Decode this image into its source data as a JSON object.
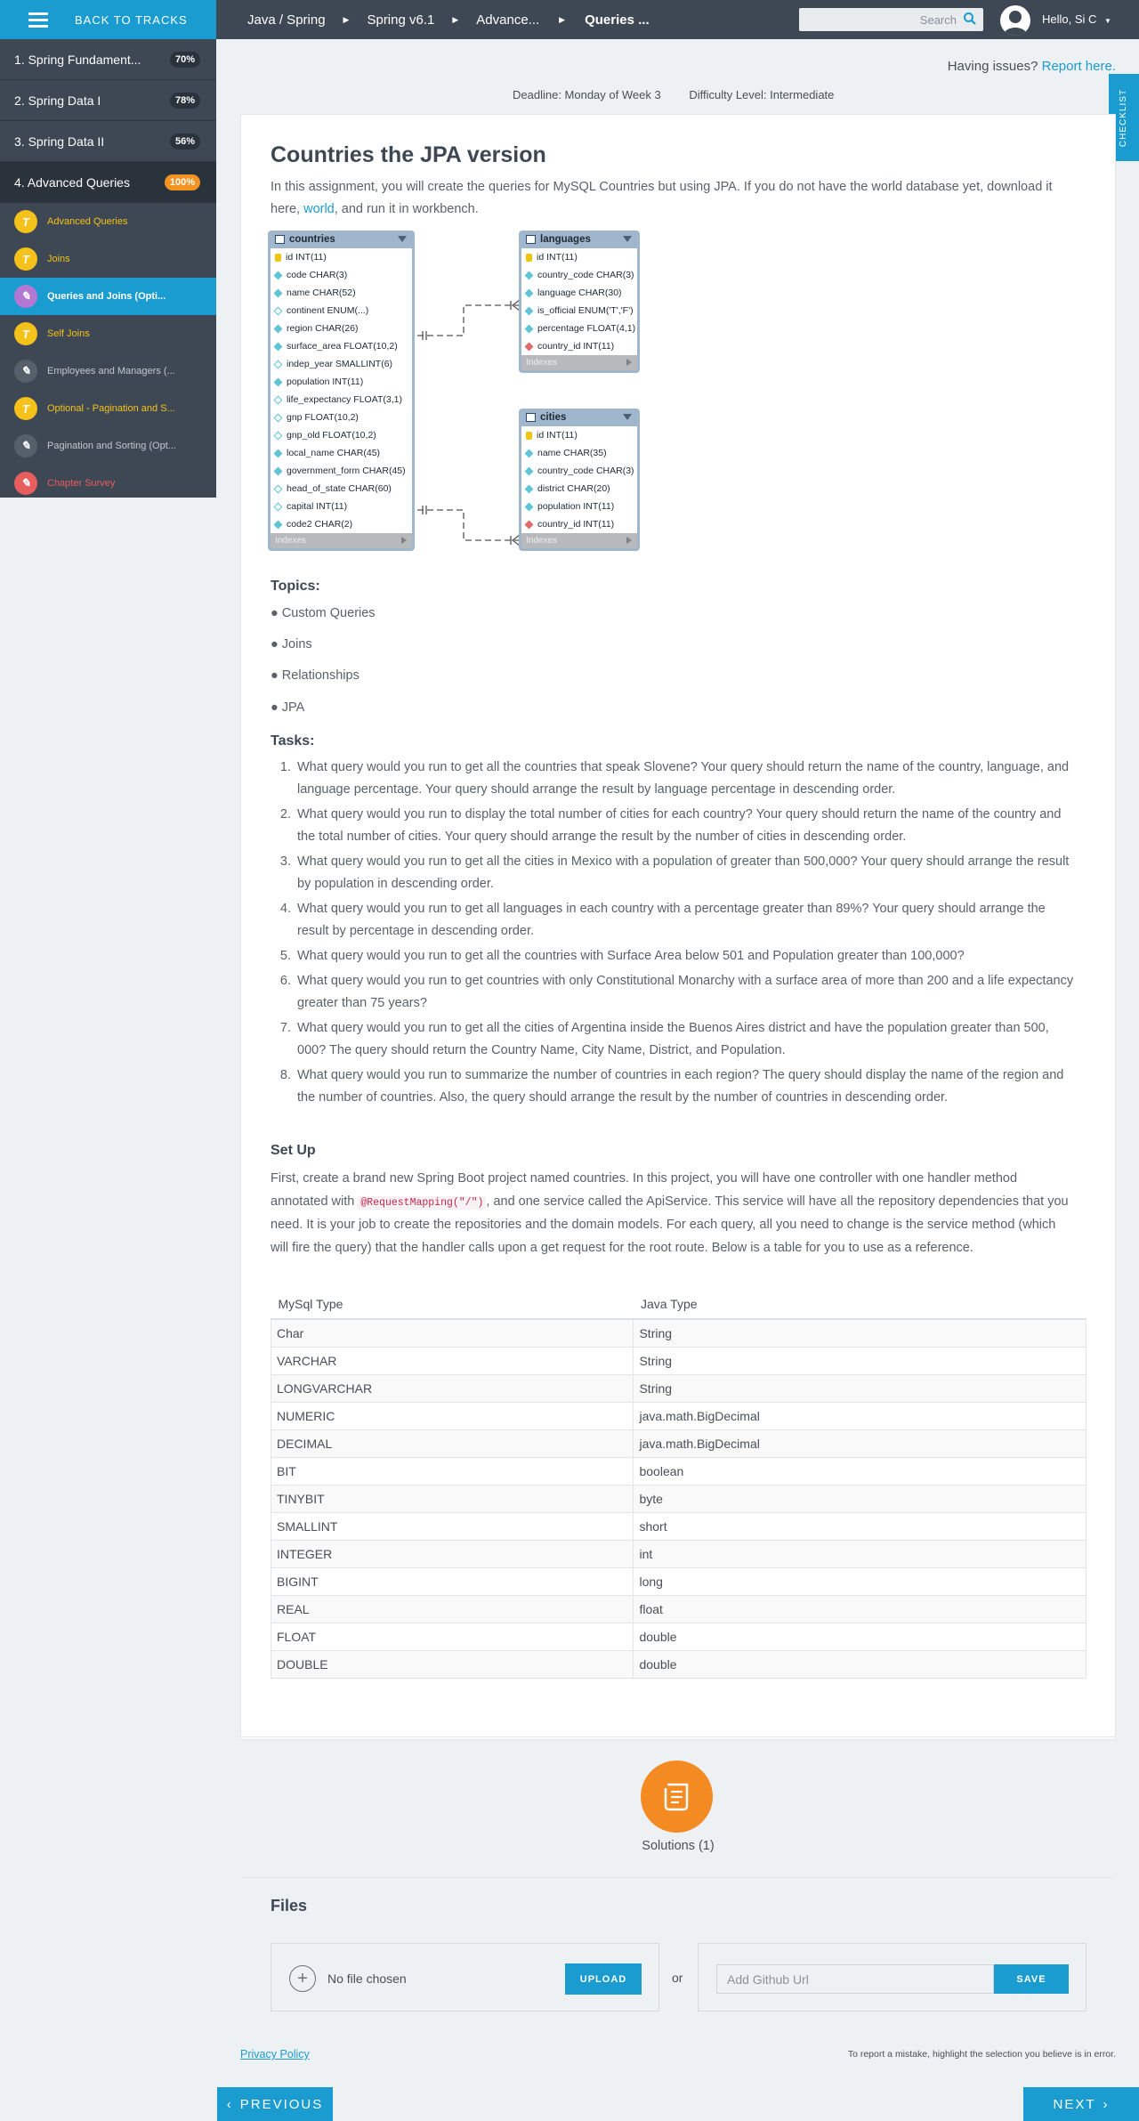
{
  "topbar": {
    "back_label": "BACK TO TRACKS",
    "breadcrumbs": [
      "Java / Spring",
      "Spring v6.1",
      "Advance...",
      "Queries ..."
    ],
    "search_placeholder": "Search",
    "user": "Hello, Si C"
  },
  "sidebar": {
    "tracks": [
      {
        "label": "1. Spring Fundament...",
        "progress": "70%"
      },
      {
        "label": "2. Spring Data I",
        "progress": "78%"
      },
      {
        "label": "3. Spring Data II",
        "progress": "56%"
      },
      {
        "label": "4. Advanced Queries",
        "progress": "100%"
      }
    ],
    "items": [
      {
        "label": "Advanced Queries",
        "icon": "t-icon"
      },
      {
        "label": "Joins",
        "icon": "t-icon"
      },
      {
        "label": "Queries and Joins (Opti...",
        "icon": "pencil-icon"
      },
      {
        "label": "Self Joins",
        "icon": "t-icon"
      },
      {
        "label": "Employees and Managers (...",
        "icon": "pencil-icon"
      },
      {
        "label": "Optional - Pagination and S...",
        "icon": "t-icon"
      },
      {
        "label": "Pagination and Sorting (Opt...",
        "icon": "pencil-icon"
      },
      {
        "label": "Chapter Survey",
        "icon": "survey-icon"
      }
    ]
  },
  "checklist_label": "CHECKLIST",
  "issues": {
    "text": "Having issues?",
    "link": "Report here."
  },
  "meta": {
    "deadline": "Deadline: Monday of Week 3",
    "difficulty": "Difficulty Level: Intermediate"
  },
  "assignment": {
    "title": "Countries the JPA version",
    "intro_1": "In this assignment, you will create the queries for MySQL Countries but using JPA. If you do not have the world database yet, download it here,",
    "intro_link": "world",
    "intro_2": ", and run it in workbench."
  },
  "er": {
    "countries": {
      "name": "countries",
      "columns": [
        "id INT(11)",
        "code CHAR(3)",
        "name CHAR(52)",
        "continent ENUM(...)",
        "region CHAR(26)",
        "surface_area FLOAT(10,2)",
        "indep_year SMALLINT(6)",
        "population INT(11)",
        "life_expectancy FLOAT(3,1)",
        "gnp FLOAT(10,2)",
        "gnp_old FLOAT(10,2)",
        "local_name CHAR(45)",
        "government_form CHAR(45)",
        "head_of_state CHAR(60)",
        "capital INT(11)",
        "code2 CHAR(2)"
      ]
    },
    "languages": {
      "name": "languages",
      "columns": [
        "id INT(11)",
        "country_code CHAR(3)",
        "language CHAR(30)",
        "is_official ENUM('T','F')",
        "percentage FLOAT(4,1)",
        "country_id INT(11)"
      ]
    },
    "cities": {
      "name": "cities",
      "columns": [
        "id INT(11)",
        "name CHAR(35)",
        "country_code CHAR(3)",
        "district CHAR(20)",
        "population INT(11)",
        "country_id INT(11)"
      ]
    },
    "indexes_label": "Indexes"
  },
  "topics": {
    "heading": "Topics:",
    "items": [
      "Custom Queries",
      "Joins",
      "Relationships",
      "JPA"
    ]
  },
  "tasks": {
    "heading": "Tasks:",
    "items": [
      "What query would you run to get all the countries that speak Slovene? Your query should return the name of the country, language, and language percentage. Your query should arrange the result by language percentage in descending order.",
      "What query would you run to display the total number of cities for each country? Your query should return the name of the country and the total number of cities. Your query should arrange the result by the number of cities in descending order.",
      "What query would you run to get all the cities in Mexico with a population of greater than 500,000? Your query should arrange the result by population in descending order.",
      "What query would you run to get all languages in each country with a percentage greater than 89%? Your query should arrange the result by percentage in descending order.",
      "What query would you run to get all the countries with Surface Area below 501 and Population greater than 100,000?",
      "What query would you run to get countries with only Constitutional Monarchy with a surface area of more than 200 and a life expectancy greater than 75 years?",
      "What query would you run to get all the cities of Argentina inside the Buenos Aires district and have the population greater than 500, 000? The query should return the Country Name, City Name, District, and Population.",
      "What query would you run to summarize the number of countries in each region? The query should display the name of the region and the number of countries. Also, the query should arrange the result by the number of countries in descending order."
    ]
  },
  "setup": {
    "heading": "Set Up",
    "text_1": "First, create a brand new Spring Boot project named countries. In this project, you will have one controller with one handler method annotated with",
    "code": "@RequestMapping(\"/\")",
    "text_2": ", and one service called the ApiService. This service will have all the repository dependencies that you need. It is your job to create the repositories and the domain models. For each query, all you need to change is the service method (which will fire the query) that the handler calls upon a get request for the root route. Below is a table for you to use as a reference."
  },
  "type_table": {
    "headers": [
      "MySql Type",
      "Java Type"
    ],
    "rows": [
      [
        "Char",
        "String"
      ],
      [
        "VARCHAR",
        "String"
      ],
      [
        "LONGVARCHAR",
        "String"
      ],
      [
        "NUMERIC",
        "java.math.BigDecimal"
      ],
      [
        "DECIMAL",
        "java.math.BigDecimal"
      ],
      [
        "BIT",
        "boolean"
      ],
      [
        "TINYBIT",
        "byte"
      ],
      [
        "SMALLINT",
        "short"
      ],
      [
        "INTEGER",
        "int"
      ],
      [
        "BIGINT",
        "long"
      ],
      [
        "REAL",
        "float"
      ],
      [
        "FLOAT",
        "double"
      ],
      [
        "DOUBLE",
        "double"
      ]
    ]
  },
  "solutions_label": "Solutions (1)",
  "files": {
    "heading": "Files",
    "no_file": "No file chosen",
    "upload": "UPLOAD",
    "or": "or",
    "github_placeholder": "Add Github Url",
    "save": "SAVE"
  },
  "footer": {
    "privacy": "Privacy Policy",
    "report": "To report a mistake, highlight the selection you believe is in error.",
    "previous": "PREVIOUS",
    "next": "NEXT"
  }
}
